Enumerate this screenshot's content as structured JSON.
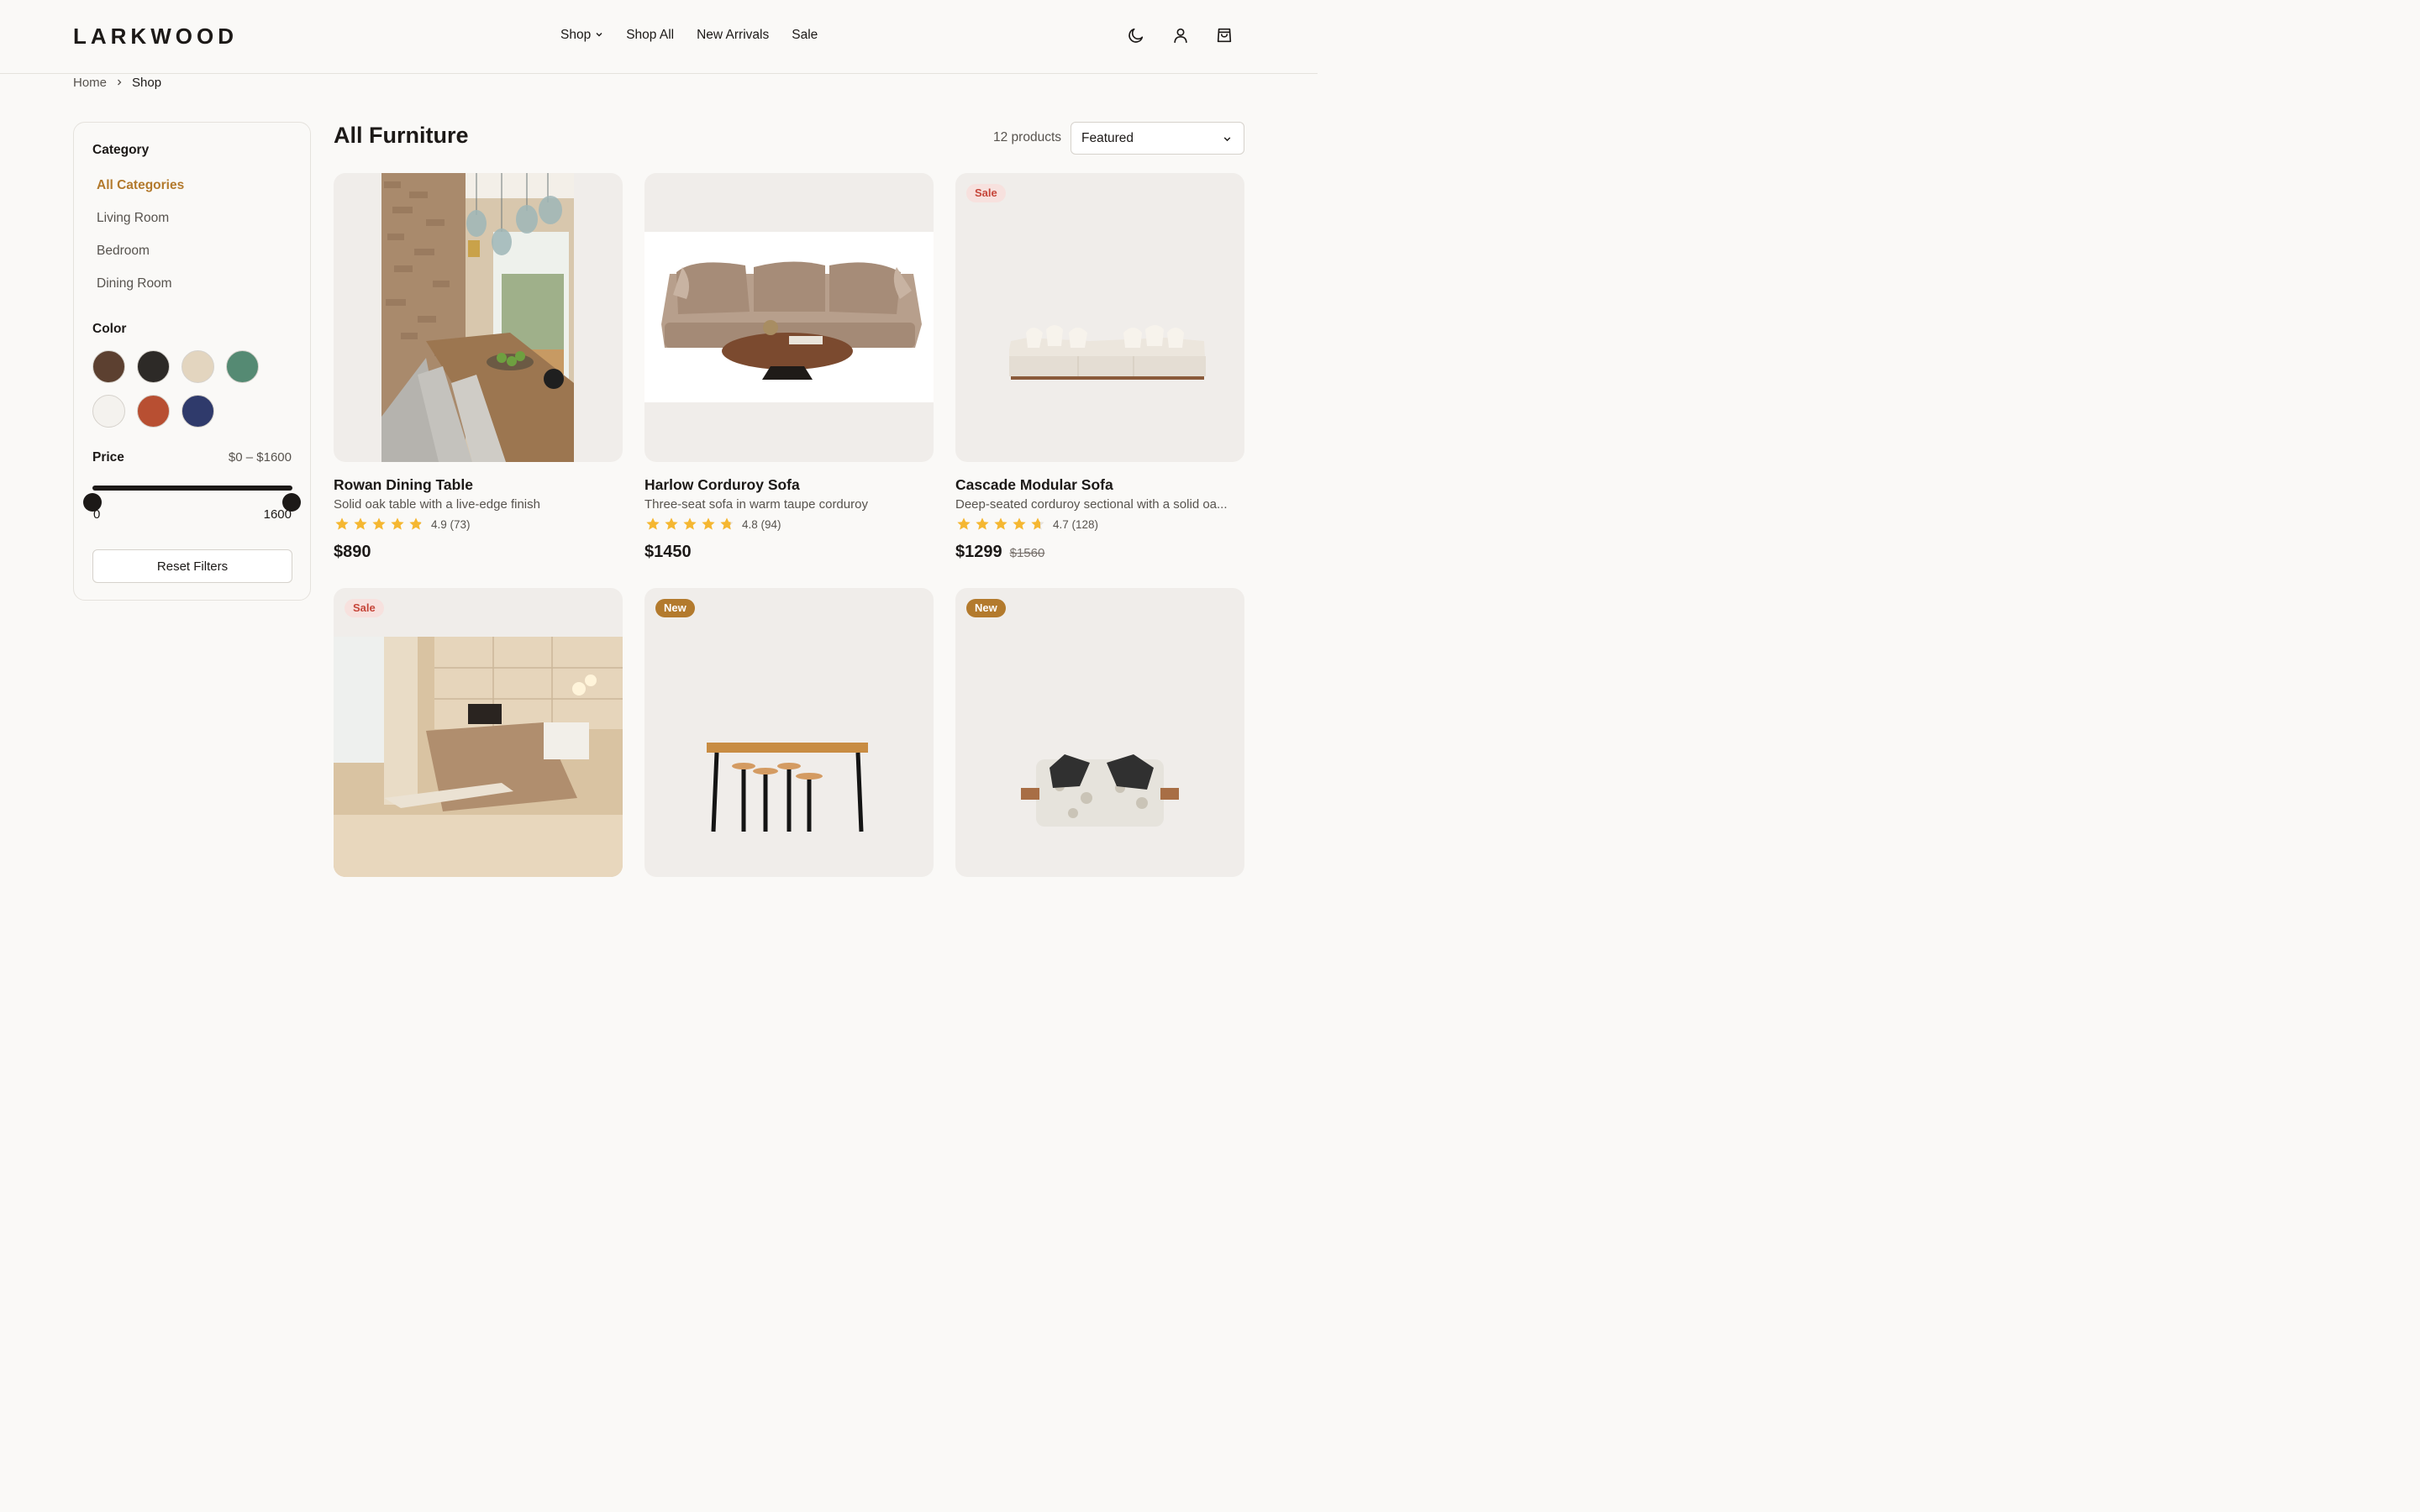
{
  "header": {
    "logo": "LARKWOOD",
    "nav": [
      {
        "label": "Shop",
        "dropdown": true
      },
      {
        "label": "Shop All"
      },
      {
        "label": "New Arrivals"
      },
      {
        "label": "Sale"
      }
    ],
    "icons": [
      "moon-icon",
      "user-icon",
      "cart-icon"
    ]
  },
  "breadcrumb": {
    "home": "Home",
    "current": "Shop"
  },
  "filters": {
    "category_heading": "Category",
    "categories": [
      {
        "label": "All Categories",
        "active": true
      },
      {
        "label": "Living Room"
      },
      {
        "label": "Bedroom"
      },
      {
        "label": "Dining Room"
      }
    ],
    "color_heading": "Color",
    "colors": [
      "#5c4030",
      "#2d2a27",
      "#e3d5bf",
      "#558a73",
      "#f4f2ee",
      "#b84f32",
      "#2f3a6b"
    ],
    "price_heading": "Price",
    "price_range": "$0 – $1600",
    "price_min": "0",
    "price_max": "1600",
    "reset_label": "Reset Filters"
  },
  "main": {
    "title": "All Furniture",
    "count": "12 products",
    "sort_value": "Featured"
  },
  "products": [
    {
      "name": "Rowan Dining Table",
      "desc": "Solid oak table with a live-edge finish",
      "rating": 4.9,
      "rating_text": "4.9 (73)",
      "price": "$890",
      "image": "dining-room-photo"
    },
    {
      "name": "Harlow Corduroy Sofa",
      "desc": "Three-seat sofa in warm taupe corduroy",
      "rating": 4.8,
      "rating_text": "4.8 (94)",
      "price": "$1450",
      "image": "taupe-sofa-photo"
    },
    {
      "name": "Cascade Modular Sofa",
      "desc": "Deep-seated corduroy sectional with a solid oa...",
      "rating": 4.7,
      "rating_text": "4.7 (128)",
      "price": "$1299",
      "old_price": "$1560",
      "badge": "Sale",
      "image": "white-modular-sofa-photo"
    },
    {
      "badge": "Sale",
      "image": "bedroom-photo"
    },
    {
      "badge": "New",
      "image": "bar-table-stools-photo"
    },
    {
      "badge": "New",
      "image": "floral-armchair-photo"
    }
  ]
}
